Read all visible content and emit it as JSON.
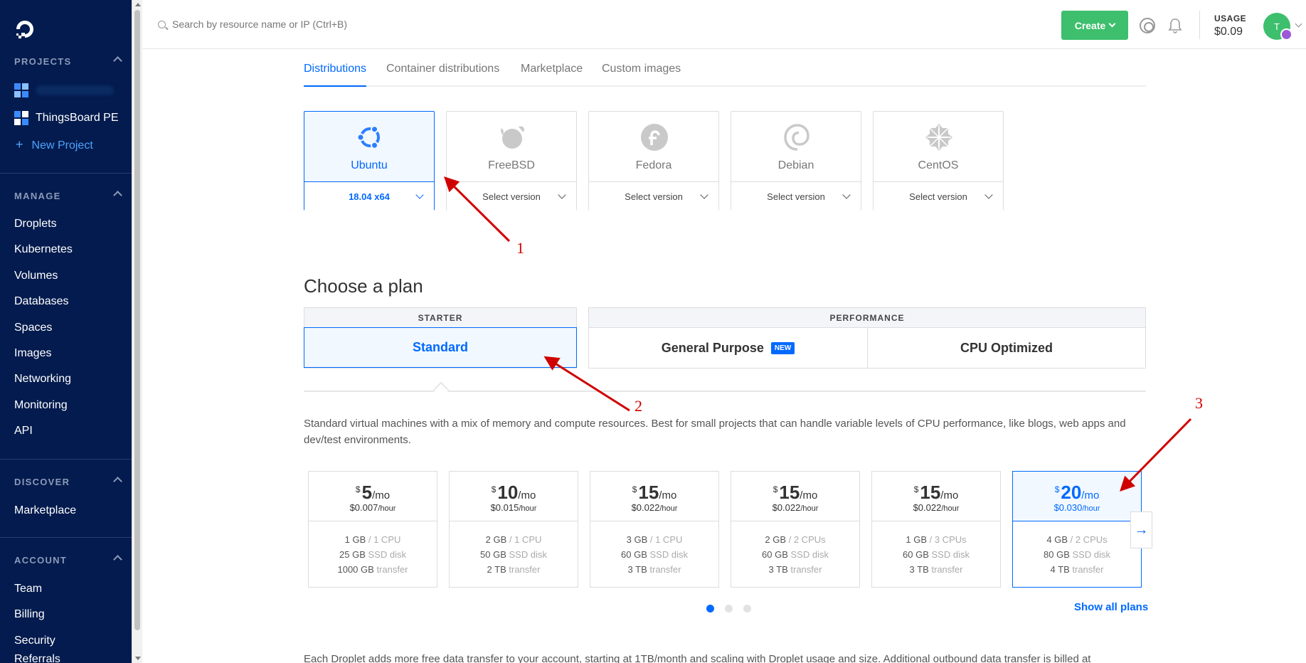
{
  "sidebar": {
    "projects_header": "PROJECTS",
    "projects": [
      {
        "label": ""
      },
      {
        "label": "ThingsBoard PE"
      }
    ],
    "new_project": "New Project",
    "manage_header": "MANAGE",
    "manage_items": [
      "Droplets",
      "Kubernetes",
      "Volumes",
      "Databases",
      "Spaces",
      "Images",
      "Networking",
      "Monitoring",
      "API"
    ],
    "discover_header": "DISCOVER",
    "discover_items": [
      "Marketplace"
    ],
    "account_header": "ACCOUNT",
    "account_items": [
      "Team",
      "Billing",
      "Security",
      "Referrals"
    ]
  },
  "topbar": {
    "search_placeholder": "Search by resource name or IP (Ctrl+B)",
    "create_label": "Create",
    "usage_label": "USAGE",
    "usage_value": "$0.09",
    "avatar_initial": "T"
  },
  "tabs": [
    "Distributions",
    "Container distributions",
    "Marketplace",
    "Custom images"
  ],
  "distros": [
    {
      "name": "Ubuntu",
      "version": "18.04 x64"
    },
    {
      "name": "FreeBSD",
      "version": "Select version"
    },
    {
      "name": "Fedora",
      "version": "Select version"
    },
    {
      "name": "Debian",
      "version": "Select version"
    },
    {
      "name": "CentOS",
      "version": "Select version"
    }
  ],
  "plan": {
    "title": "Choose a plan",
    "starter_header": "STARTER",
    "performance_header": "PERFORMANCE",
    "standard": "Standard",
    "general_purpose": "General Purpose",
    "new_badge": "NEW",
    "cpu_optimized": "CPU Optimized",
    "description": "Standard virtual machines with a mix of memory and compute resources. Best for small projects that can handle variable levels of CPU performance, like blogs, web apps and dev/test environments."
  },
  "price_cards": [
    {
      "dollar": "$",
      "amount": "5",
      "per": "/mo",
      "hourly": "$0.007",
      "hour_unit": "/hour",
      "mem": "1 GB",
      "cpu": "/ 1 CPU",
      "disk": "25 GB",
      "disk_unit": "SSD disk",
      "transfer": "1000 GB",
      "transfer_unit": "transfer"
    },
    {
      "dollar": "$",
      "amount": "10",
      "per": "/mo",
      "hourly": "$0.015",
      "hour_unit": "/hour",
      "mem": "2 GB",
      "cpu": "/ 1 CPU",
      "disk": "50 GB",
      "disk_unit": "SSD disk",
      "transfer": "2 TB",
      "transfer_unit": "transfer"
    },
    {
      "dollar": "$",
      "amount": "15",
      "per": "/mo",
      "hourly": "$0.022",
      "hour_unit": "/hour",
      "mem": "3 GB",
      "cpu": "/ 1 CPU",
      "disk": "60 GB",
      "disk_unit": "SSD disk",
      "transfer": "3 TB",
      "transfer_unit": "transfer"
    },
    {
      "dollar": "$",
      "amount": "15",
      "per": "/mo",
      "hourly": "$0.022",
      "hour_unit": "/hour",
      "mem": "2 GB",
      "cpu": "/ 2 CPUs",
      "disk": "60 GB",
      "disk_unit": "SSD disk",
      "transfer": "3 TB",
      "transfer_unit": "transfer"
    },
    {
      "dollar": "$",
      "amount": "15",
      "per": "/mo",
      "hourly": "$0.022",
      "hour_unit": "/hour",
      "mem": "1 GB",
      "cpu": "/ 3 CPUs",
      "disk": "60 GB",
      "disk_unit": "SSD disk",
      "transfer": "3 TB",
      "transfer_unit": "transfer"
    },
    {
      "dollar": "$",
      "amount": "20",
      "per": "/mo",
      "hourly": "$0.030",
      "hour_unit": "/hour",
      "mem": "4 GB",
      "cpu": "/ 2 CPUs",
      "disk": "80 GB",
      "disk_unit": "SSD disk",
      "transfer": "4 TB",
      "transfer_unit": "transfer"
    }
  ],
  "show_all_plans": "Show all plans",
  "footer_text": "Each Droplet adds more free data transfer to your account, starting at 1TB/month and scaling with Droplet usage and size. Additional outbound data transfer is billed at",
  "annotations": [
    "1",
    "2",
    "3"
  ],
  "colors": {
    "sidebar_bg": "#031b4e",
    "accent": "#0069ff",
    "create_green": "#3dbf6d",
    "annotation_red": "#d00000"
  }
}
